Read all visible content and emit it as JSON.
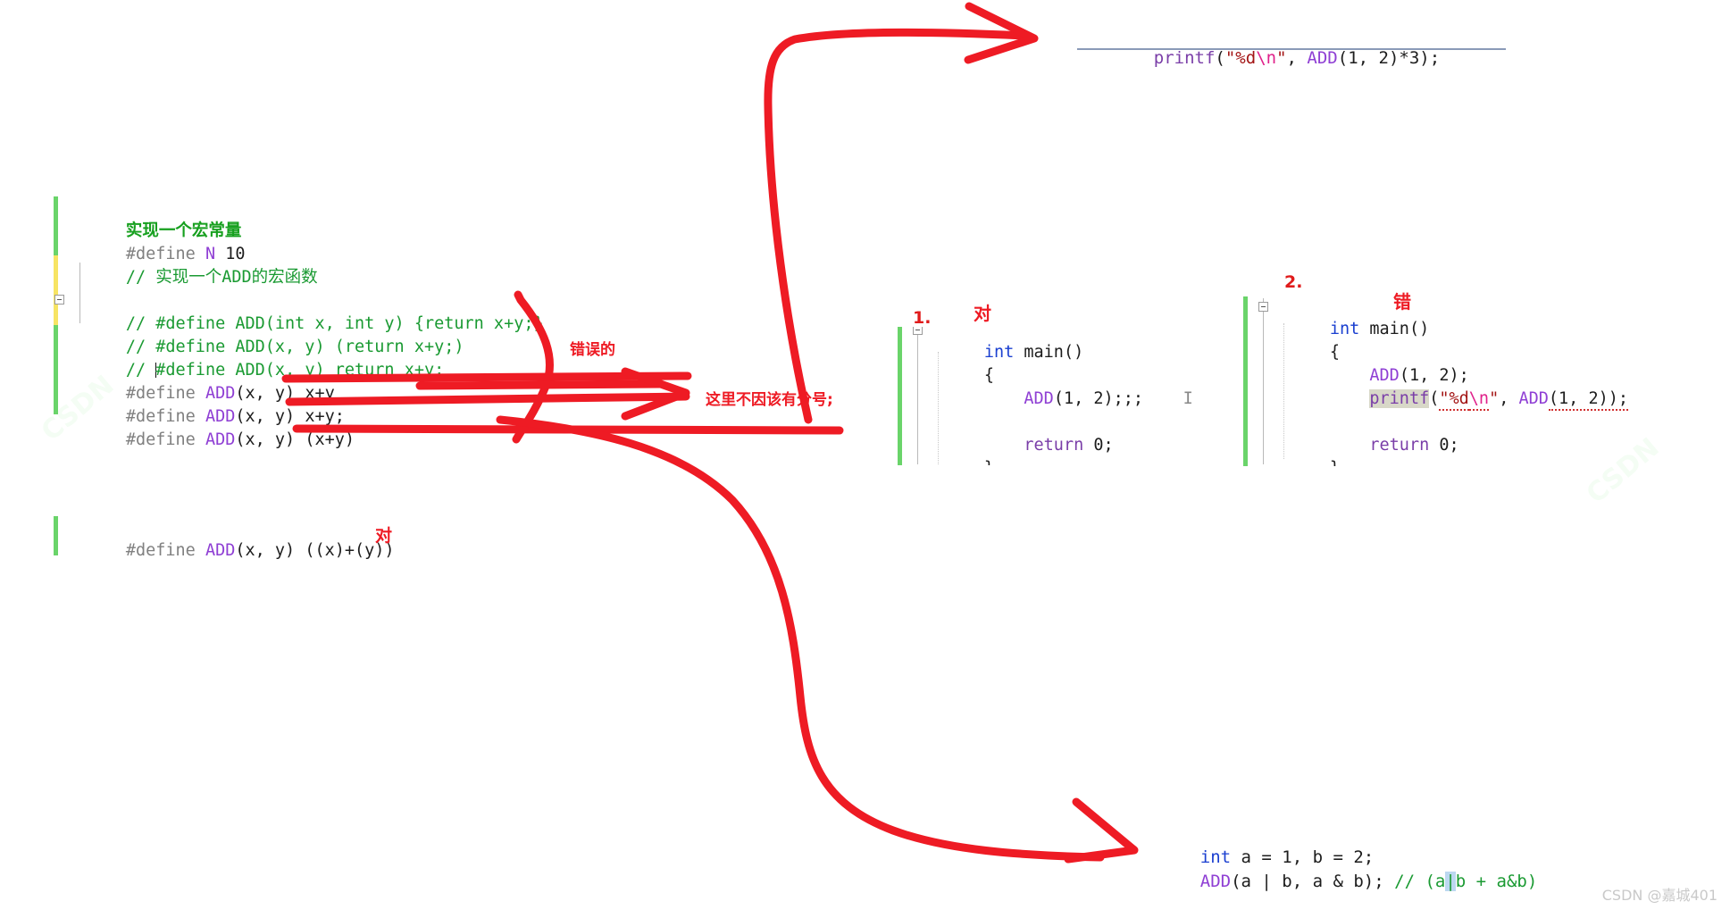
{
  "watermarks": {
    "corner": "CSDN @嘉城401",
    "faint1": "CSDN",
    "faint2": "CSDN"
  },
  "top_snippet": {
    "name": "printf-add-times-three",
    "tokens": {
      "fn": "printf",
      "open": "(",
      "str": "\"%d",
      "esc": "\\n",
      "str_end": "\"",
      "comma": ", ",
      "macro": "ADD",
      "args": "(1, 2)*3);"
    },
    "full_text": "printf(\"%d\\n\", ADD(1, 2)*3);"
  },
  "left_block": {
    "name": "macro-definitions",
    "lines": [
      {
        "id": "l1",
        "kind": "comment-bold",
        "text": "实现一个宏常量"
      },
      {
        "id": "l2",
        "kind": "define-n",
        "pp": "#define ",
        "macro": "N",
        "rest": " 10"
      },
      {
        "id": "l3",
        "kind": "comment",
        "text": "// 实现一个ADD的宏函数"
      },
      {
        "id": "l4",
        "kind": "blank",
        "text": ""
      },
      {
        "id": "l5",
        "kind": "comment",
        "text": "// #define ADD(int x, int y) {return x+y;}"
      },
      {
        "id": "l6",
        "kind": "comment",
        "text": "// #define ADD(x, y) (return x+y;)"
      },
      {
        "id": "l7",
        "kind": "comment-cur",
        "text": "// #define ADD(x, y) return x+y;"
      },
      {
        "id": "l8",
        "kind": "define-add",
        "pp": "#define ",
        "macro": "ADD",
        "rest": "(x, y) x+y"
      },
      {
        "id": "l9",
        "kind": "define-add",
        "pp": "#define ",
        "macro": "ADD",
        "rest": "(x, y) x+y;"
      },
      {
        "id": "l10",
        "kind": "define-add",
        "pp": "#define ",
        "macro": "ADD",
        "rest": "(x, y) (x+y)"
      }
    ]
  },
  "bottom_left_block": {
    "name": "correct-macro-definition",
    "pp": "#define ",
    "macro": "ADD",
    "rest": "(x, y) ((x)+(y))",
    "verdict": "对"
  },
  "annotations": {
    "wrong_label": "错误的",
    "semicolon_note": "这里不因该有分号;",
    "marker_1": "1.",
    "marker_2": "2.",
    "verdict_correct": "对",
    "verdict_wrong": "错"
  },
  "mid_block_1": {
    "name": "main-with-extra-semicolons",
    "lines": [
      {
        "id": "m1",
        "kind": "signature",
        "kw": "int",
        "rest": " main()"
      },
      {
        "id": "m2",
        "kind": "plain",
        "text": "{"
      },
      {
        "id": "m3",
        "kind": "call-cur",
        "macro": "ADD",
        "rest": "(1, 2);;;"
      },
      {
        "id": "m4",
        "kind": "blank",
        "text": ""
      },
      {
        "id": "m5",
        "kind": "return",
        "kw": "return",
        "rest": " 0;"
      },
      {
        "id": "m6",
        "kind": "plain",
        "text": "}"
      }
    ]
  },
  "mid_block_2": {
    "name": "main-with-printf",
    "lines": [
      {
        "id": "n1",
        "kind": "signature",
        "kw": "int",
        "rest": " main()"
      },
      {
        "id": "n2",
        "kind": "plain",
        "text": "{"
      },
      {
        "id": "n3",
        "kind": "call",
        "macro": "ADD",
        "rest": "(1, 2);"
      },
      {
        "id": "n4",
        "kind": "printf-cur",
        "fn": "printf",
        "open": "(",
        "str": "\"%d",
        "esc": "\\n",
        "str_end": "\"",
        "comma": ", ",
        "macro": "ADD",
        "tail": "(1, 2));"
      },
      {
        "id": "n5",
        "kind": "blank",
        "text": ""
      },
      {
        "id": "n6",
        "kind": "return",
        "kw": "return",
        "rest": " 0;"
      },
      {
        "id": "n7",
        "kind": "plain",
        "text": "}"
      }
    ]
  },
  "bottom_right_block": {
    "name": "operator-precedence-example",
    "line1": {
      "kw": "int",
      "rest": " a = 1, b = 2;"
    },
    "line2": {
      "macro": "ADD",
      "args": "(a | b, a & b); ",
      "comment_head": "// (a",
      "pipe": "|",
      "comment_tail": "b + a&b)"
    }
  },
  "colors": {
    "ink_red": "#ee1b24",
    "annotation_red": "#e01b1b",
    "gutter_green": "#6ad46a",
    "gutter_yellow": "#f7e463",
    "macro_purple": "#8f3fd4",
    "comment_green": "#1a9a32",
    "keyword_blue": "#1a3fd0",
    "string_red": "#a31515"
  }
}
